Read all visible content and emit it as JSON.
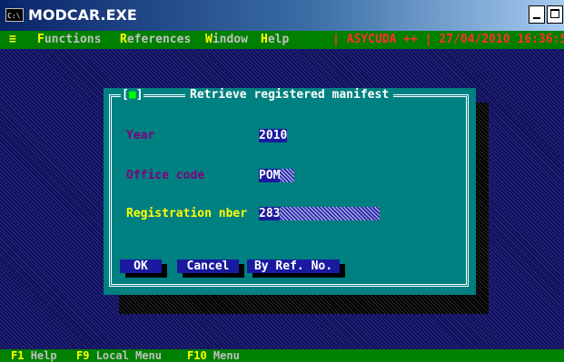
{
  "window": {
    "icon_text": "C:\\",
    "title": "MODCAR.EXE"
  },
  "menubar": {
    "system_menu": "≡",
    "items": [
      {
        "hotkey": "F",
        "rest": "unctions"
      },
      {
        "hotkey": "R",
        "rest": "eferences"
      },
      {
        "hotkey": "W",
        "rest": "indow"
      },
      {
        "hotkey": "H",
        "rest": "elp"
      }
    ],
    "info": "| ASYCUDA ++ | 27/04/2010 16:36:5"
  },
  "dialog": {
    "close_marker": "■",
    "title": "Retrieve registered manifest",
    "fields": [
      {
        "label": "Year",
        "value": "2010"
      },
      {
        "label": "Office code",
        "value": "POM"
      },
      {
        "label": "Registration nber",
        "value": "283"
      }
    ],
    "buttons": {
      "ok": "OK",
      "cancel": "Cancel",
      "by_ref": "By Ref. No."
    }
  },
  "statusbar": {
    "items": [
      {
        "key": "F1",
        "label": "Help"
      },
      {
        "key": "F9",
        "label": "Local Menu"
      },
      {
        "key": "F10",
        "label": "Menu"
      }
    ]
  },
  "colors": {
    "desktop_blue": "#1e1e6e",
    "menubar_green": "#008000",
    "dialog_teal": "#008080",
    "hotkey_yellow": "#ffff00",
    "label_purple": "#800080",
    "field_blue": "#1a1aa0",
    "info_red": "#ff3030"
  }
}
